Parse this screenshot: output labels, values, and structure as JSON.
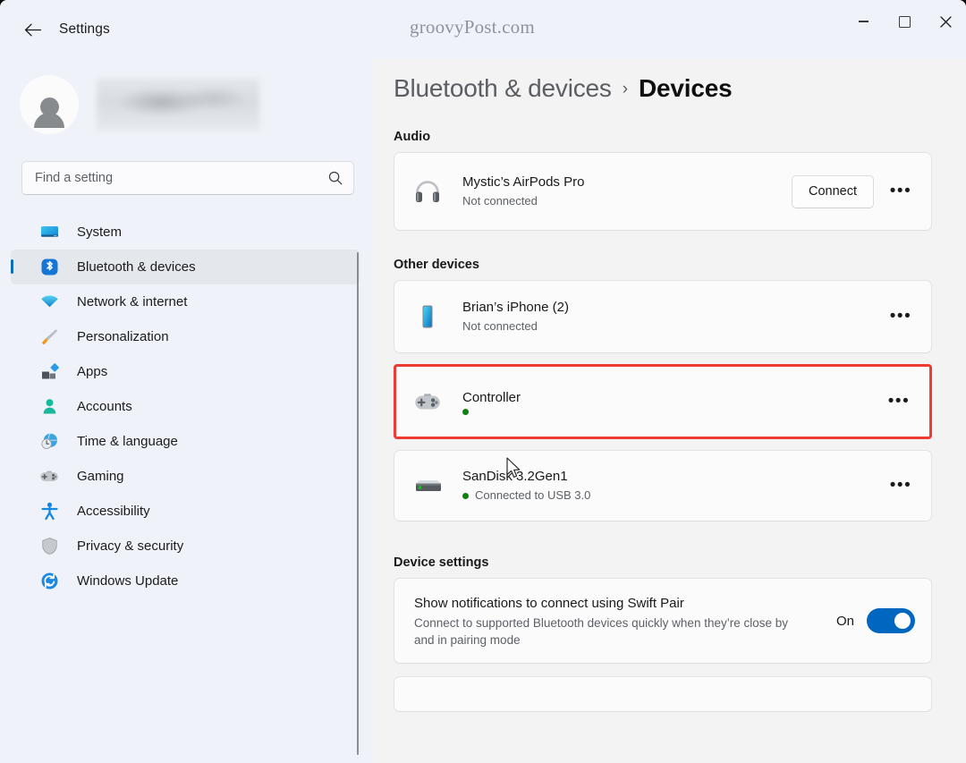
{
  "titlebar": {
    "back_label": "back-arrow",
    "app_title": "Settings",
    "watermark": "groovyPost.com",
    "minimize_label": "Minimize",
    "maximize_label": "Maximize",
    "close_label": "Close"
  },
  "sidebar": {
    "profile_name": "",
    "search": {
      "placeholder": "Find a setting",
      "value": ""
    },
    "items": [
      {
        "label": "System",
        "icon": "monitor-icon",
        "selected": false
      },
      {
        "label": "Bluetooth & devices",
        "icon": "bluetooth-icon",
        "selected": true
      },
      {
        "label": "Network & internet",
        "icon": "wifi-icon",
        "selected": false
      },
      {
        "label": "Personalization",
        "icon": "paintbrush-icon",
        "selected": false
      },
      {
        "label": "Apps",
        "icon": "apps-icon",
        "selected": false
      },
      {
        "label": "Accounts",
        "icon": "person-icon",
        "selected": false
      },
      {
        "label": "Time & language",
        "icon": "clock-globe-icon",
        "selected": false
      },
      {
        "label": "Gaming",
        "icon": "gamepad-icon",
        "selected": false
      },
      {
        "label": "Accessibility",
        "icon": "accessibility-icon",
        "selected": false
      },
      {
        "label": "Privacy & security",
        "icon": "shield-icon",
        "selected": false
      },
      {
        "label": "Windows Update",
        "icon": "update-icon",
        "selected": false
      }
    ]
  },
  "content": {
    "breadcrumb": {
      "parent": "Bluetooth & devices",
      "separator": "›",
      "current": "Devices"
    },
    "sections": {
      "audio": {
        "title": "Audio",
        "devices": [
          {
            "name": "Mystic’s AirPods Pro",
            "status": "Not connected",
            "status_dot": false,
            "icon": "headphones-icon",
            "action_label": "Connect",
            "more_label": "•••"
          }
        ]
      },
      "other_devices": {
        "title": "Other devices",
        "devices": [
          {
            "name": "Brian’s iPhone (2)",
            "status": "Not connected",
            "status_dot": false,
            "icon": "phone-icon",
            "more_label": "•••",
            "highlighted": false
          },
          {
            "name": "Controller",
            "status": "",
            "status_dot": true,
            "icon": "gamepad-icon",
            "more_label": "•••",
            "highlighted": true
          },
          {
            "name": "SanDisk 3.2Gen1",
            "status": "Connected to USB 3.0",
            "status_dot": true,
            "icon": "drive-icon",
            "more_label": "•••",
            "highlighted": false
          }
        ]
      },
      "device_settings": {
        "title": "Device settings",
        "swift_pair": {
          "title": "Show notifications to connect using Swift Pair",
          "description": "Connect to supported Bluetooth devices quickly when they’re close by and in pairing mode",
          "state_label": "On",
          "state_on": true
        }
      }
    }
  },
  "colors": {
    "accent": "#0067C0",
    "highlight_border": "#EE3B33",
    "status_connected": "#108010",
    "sidebar_bg": "#EFF3F9",
    "content_bg": "#F3F3F3"
  }
}
